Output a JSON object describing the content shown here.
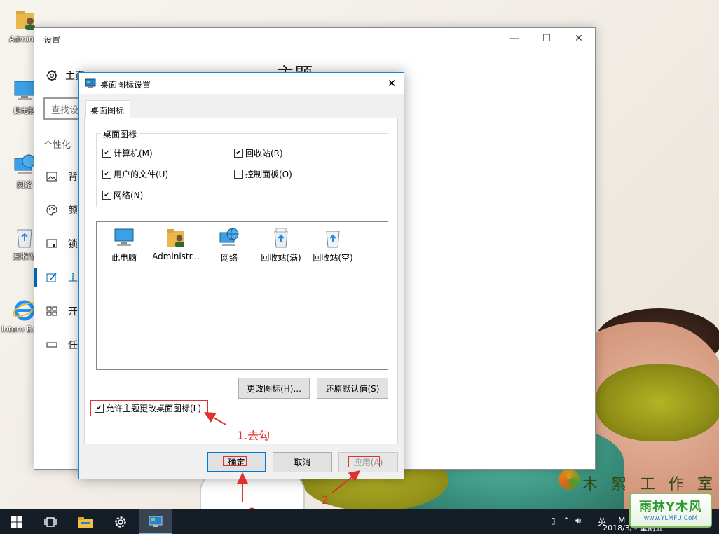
{
  "desktop": {
    "icons": [
      {
        "label": "Administ",
        "icon": "user-folder-icon"
      },
      {
        "label": "此电脑",
        "icon": "computer-icon"
      },
      {
        "label": "网络",
        "icon": "network-icon"
      },
      {
        "label": "回收站",
        "icon": "recycle-bin-icon"
      },
      {
        "label": "Intern Explo",
        "icon": "ie-icon"
      }
    ],
    "wallpaper_logo_text": "木 絮 工 作 室"
  },
  "settings": {
    "title": "设置",
    "home_label": "主页",
    "search_placeholder": "查找设置",
    "section_header": "个性化",
    "nav_items": [
      {
        "label": "背景",
        "icon": "image-icon"
      },
      {
        "label": "颜色",
        "icon": "palette-icon"
      },
      {
        "label": "锁屏界面",
        "icon": "lock-screen-icon"
      },
      {
        "label": "主题",
        "icon": "brush-icon",
        "active": true
      },
      {
        "label": "开始",
        "icon": "start-grid-icon"
      },
      {
        "label": "任务栏",
        "icon": "taskbar-icon"
      }
    ],
    "page_title": "主题",
    "controls": {
      "minimize": "—",
      "maximize": "☐",
      "close": "✕"
    }
  },
  "dialog": {
    "title": "桌面图标设置",
    "tab": "桌面图标",
    "group_label": "桌面图标",
    "checkboxes": [
      {
        "label": "计算机(M)",
        "checked": true
      },
      {
        "label": "回收站(R)",
        "checked": true
      },
      {
        "label": "用户的文件(U)",
        "checked": true
      },
      {
        "label": "控制面板(O)",
        "checked": false
      },
      {
        "label": "网络(N)",
        "checked": true
      }
    ],
    "icon_list": [
      {
        "label": "此电脑",
        "icon": "computer-icon"
      },
      {
        "label": "Administr...",
        "icon": "user-folder-icon"
      },
      {
        "label": "网络",
        "icon": "network-icon"
      },
      {
        "label": "回收站(满)",
        "icon": "recycle-bin-full-icon"
      },
      {
        "label": "回收站(空)",
        "icon": "recycle-bin-empty-icon"
      }
    ],
    "change_icon_button": "更改图标(H)...",
    "restore_default_button": "还原默认值(S)",
    "allow_themes_label": "允许主题更改桌面图标(L)",
    "allow_themes_checked": true,
    "ok_button": "确定",
    "cancel_button": "取消",
    "apply_button": "应用(A)",
    "close": "✕"
  },
  "annotations": {
    "step1": "1.去勾",
    "step2": "2",
    "step3": "3",
    "color": "#e03030"
  },
  "taskbar": {
    "tray_ime": "英",
    "tray_letter": "M",
    "clock_partial": "2018/3/9 星期五",
    "buttons": [
      "windows-start-icon",
      "task-view-icon",
      "file-explorer-icon",
      "settings-gear-icon",
      "desktop-icon-settings-app-icon"
    ]
  },
  "watermark": {
    "main": "雨林Y木风",
    "url": "www.YLMFU.CoM"
  },
  "colors": {
    "accent": "#0063b1",
    "dialog_border": "#1883d7",
    "taskbar": "#151d26"
  }
}
